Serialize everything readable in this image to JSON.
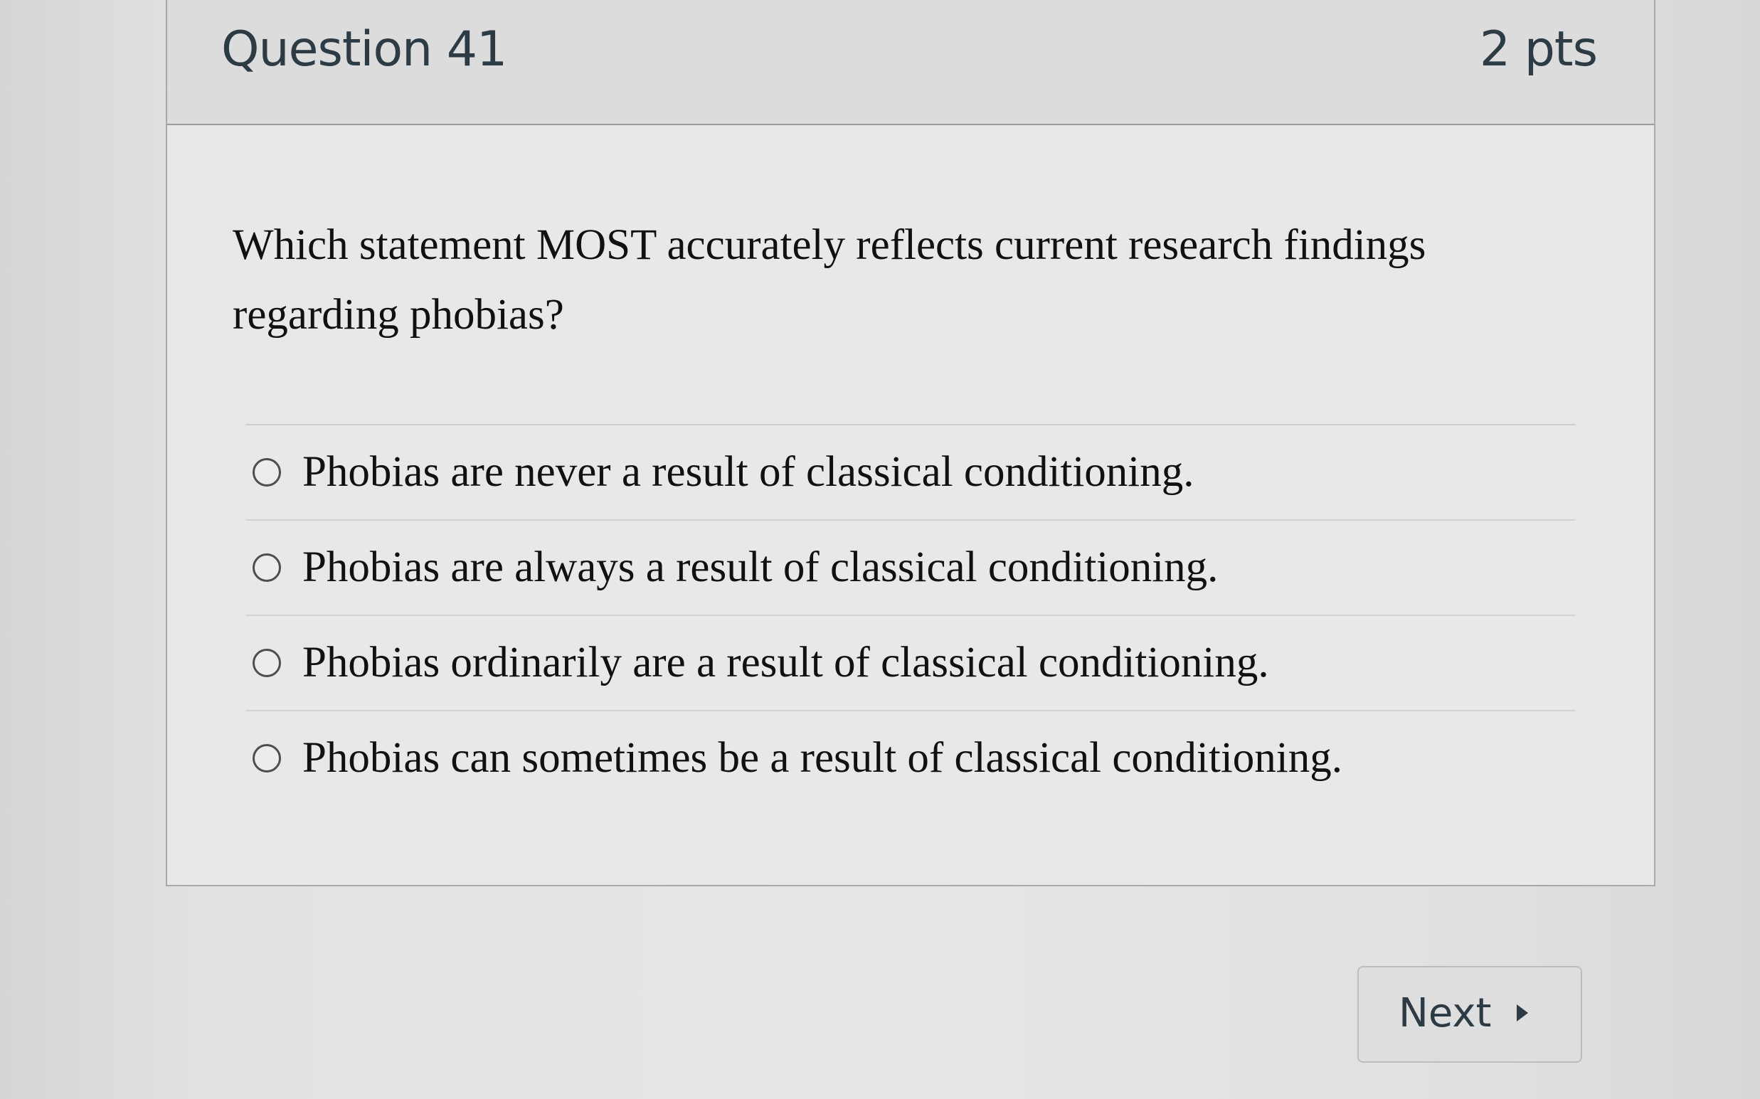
{
  "question": {
    "title": "Question 41",
    "points": "2 pts",
    "text": "Which statement MOST accurately reflects current research findings regarding phobias?"
  },
  "answers": [
    {
      "label": "Phobias are never a result of classical conditioning.",
      "selected": false
    },
    {
      "label": "Phobias are always a result of classical conditioning.",
      "selected": false
    },
    {
      "label": "Phobias ordinarily are a result of classical conditioning.",
      "selected": false
    },
    {
      "label": "Phobias can sometimes be a result of classical conditioning.",
      "selected": false
    }
  ],
  "navigation": {
    "next_label": "Next",
    "next_icon": "caret-right-icon"
  },
  "colors": {
    "heading_text": "#2d3b45",
    "body_text": "#111111",
    "header_background": "#dcdcdc",
    "card_background": "#e8e8e8"
  }
}
